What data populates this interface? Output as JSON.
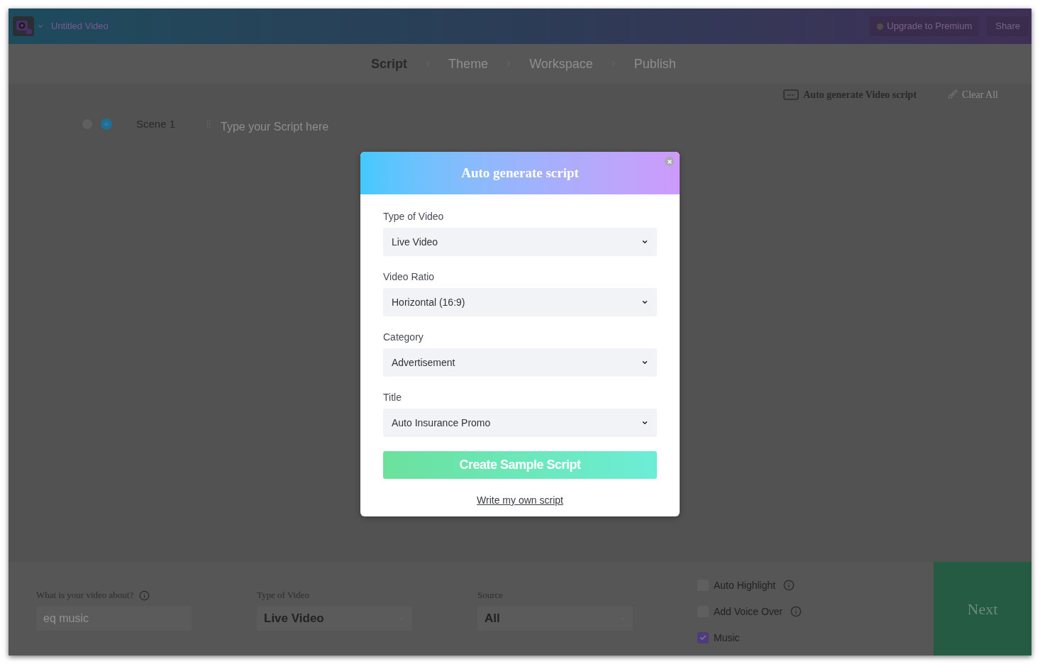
{
  "app_bar": {
    "project_title": "Untitled Video",
    "buttons": [
      {
        "kind": "upgrade",
        "label": "Upgrade to Premium"
      },
      {
        "kind": "plain",
        "label": "Share"
      }
    ]
  },
  "steps": [
    {
      "label": "Script",
      "selected": true
    },
    {
      "label": "Theme",
      "selected": false
    },
    {
      "label": "Workspace",
      "selected": false
    },
    {
      "label": "Publish",
      "selected": false
    }
  ],
  "toolbar": {
    "actions": [
      {
        "kind": "auto",
        "label": "Auto generate Video script"
      },
      {
        "kind": "clear",
        "label": "Clear All"
      }
    ]
  },
  "scenes": [
    {
      "label": "Scene 1",
      "placeholder": "Type your Script here"
    }
  ],
  "dialog": {
    "title": "Auto generate script",
    "fields": [
      {
        "label": "Type of Video",
        "value": "Live Video"
      },
      {
        "label": "Video Ratio",
        "value": "Horizontal (16:9)"
      },
      {
        "label": "Category",
        "value": "Advertisement"
      },
      {
        "label": "Title",
        "value": "Auto Insurance Promo"
      }
    ],
    "primary_button": "Create Sample Script",
    "link": "Write my own script"
  },
  "bottom_panel": {
    "topic": {
      "label": "What is your video about?",
      "placeholder": "eq music"
    },
    "selects": [
      {
        "label": "Type of Video",
        "value": "Live Video"
      },
      {
        "label": "Source",
        "value": "All"
      }
    ],
    "options": [
      {
        "label": "Auto Highlight",
        "checked": false,
        "info": true
      },
      {
        "label": "Add Voice Over",
        "checked": false,
        "info": true
      },
      {
        "label": "Music",
        "checked": true,
        "info": false
      }
    ],
    "next_button": "Next"
  }
}
